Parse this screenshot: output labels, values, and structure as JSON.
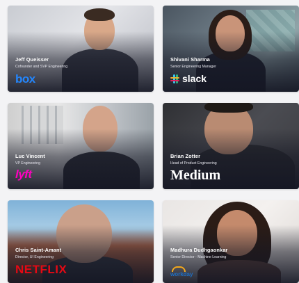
{
  "cards": [
    {
      "name": "Jeff Queisser",
      "role": "Cofounder and SVP Engineering",
      "company_logo_text": "box",
      "logo_color": "#2486fc"
    },
    {
      "name": "Shivani Sharma",
      "role": "Senior Engineering Manager",
      "company_logo_text": "slack",
      "logo_color": "#ffffff"
    },
    {
      "name": "Luc Vincent",
      "role": "VP Engineering",
      "company_logo_text": "lyft",
      "logo_color": "#ff00bf"
    },
    {
      "name": "Brian Zotter",
      "role": "Head of Product Engineering",
      "company_logo_text": "Medium",
      "logo_color": "#ffffff"
    },
    {
      "name": "Chris Saint-Amant",
      "role": "Director, UI Engineering",
      "company_logo_text": "NETFLIX",
      "logo_color": "#e50914"
    },
    {
      "name": "Madhura Dudhgaonkar",
      "role": "Senior Director - Machine Learning",
      "company_logo_text": "workday",
      "logo_color": "#1f6fc5"
    }
  ]
}
